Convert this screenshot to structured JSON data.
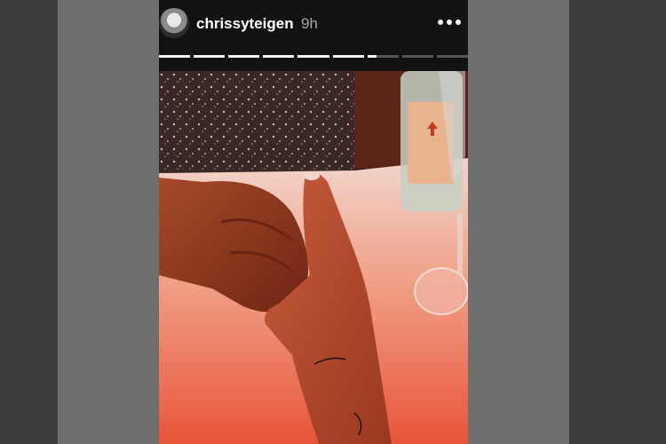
{
  "story": {
    "username": "chrissyteigen",
    "time_ago": "9h",
    "avatar_icon": "profile-avatar",
    "more_icon": "more-options-icon",
    "segments": [
      1,
      1,
      1,
      1,
      1,
      1,
      0.3,
      0,
      0
    ]
  },
  "photo": {
    "icon": "story-photo"
  }
}
